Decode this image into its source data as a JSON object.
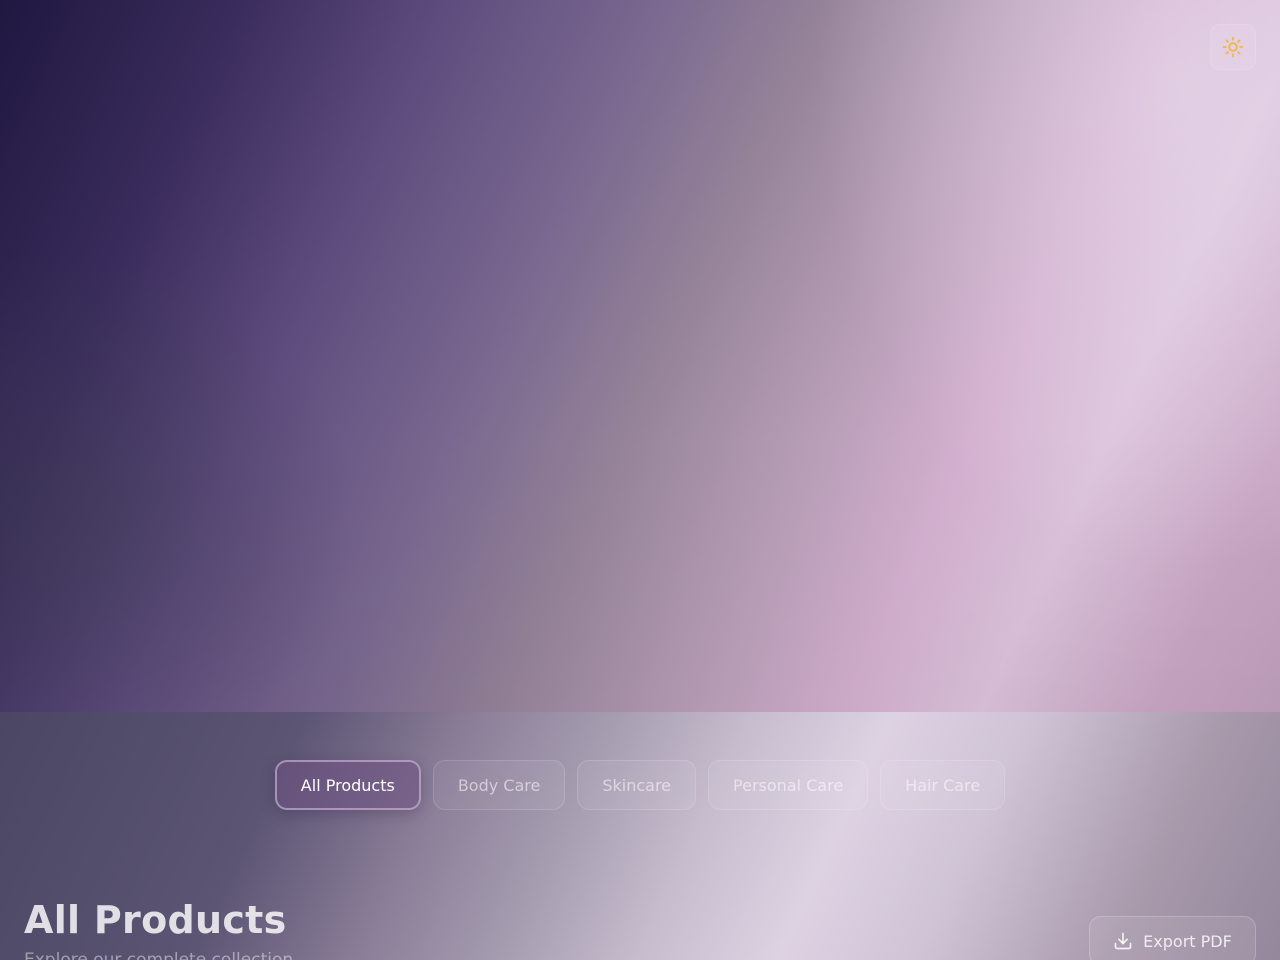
{
  "theme_toggle": {
    "icon": "sun-icon",
    "color": "#f0b84a"
  },
  "filters": [
    {
      "label": "All Products",
      "active": true
    },
    {
      "label": "Body Care",
      "active": false
    },
    {
      "label": "Skincare",
      "active": false
    },
    {
      "label": "Personal Care",
      "active": false
    },
    {
      "label": "Hair Care",
      "active": false
    }
  ],
  "section": {
    "title": "All Products",
    "subtitle": "Explore our complete collection"
  },
  "export": {
    "label": "Export PDF",
    "icon": "download-icon"
  }
}
